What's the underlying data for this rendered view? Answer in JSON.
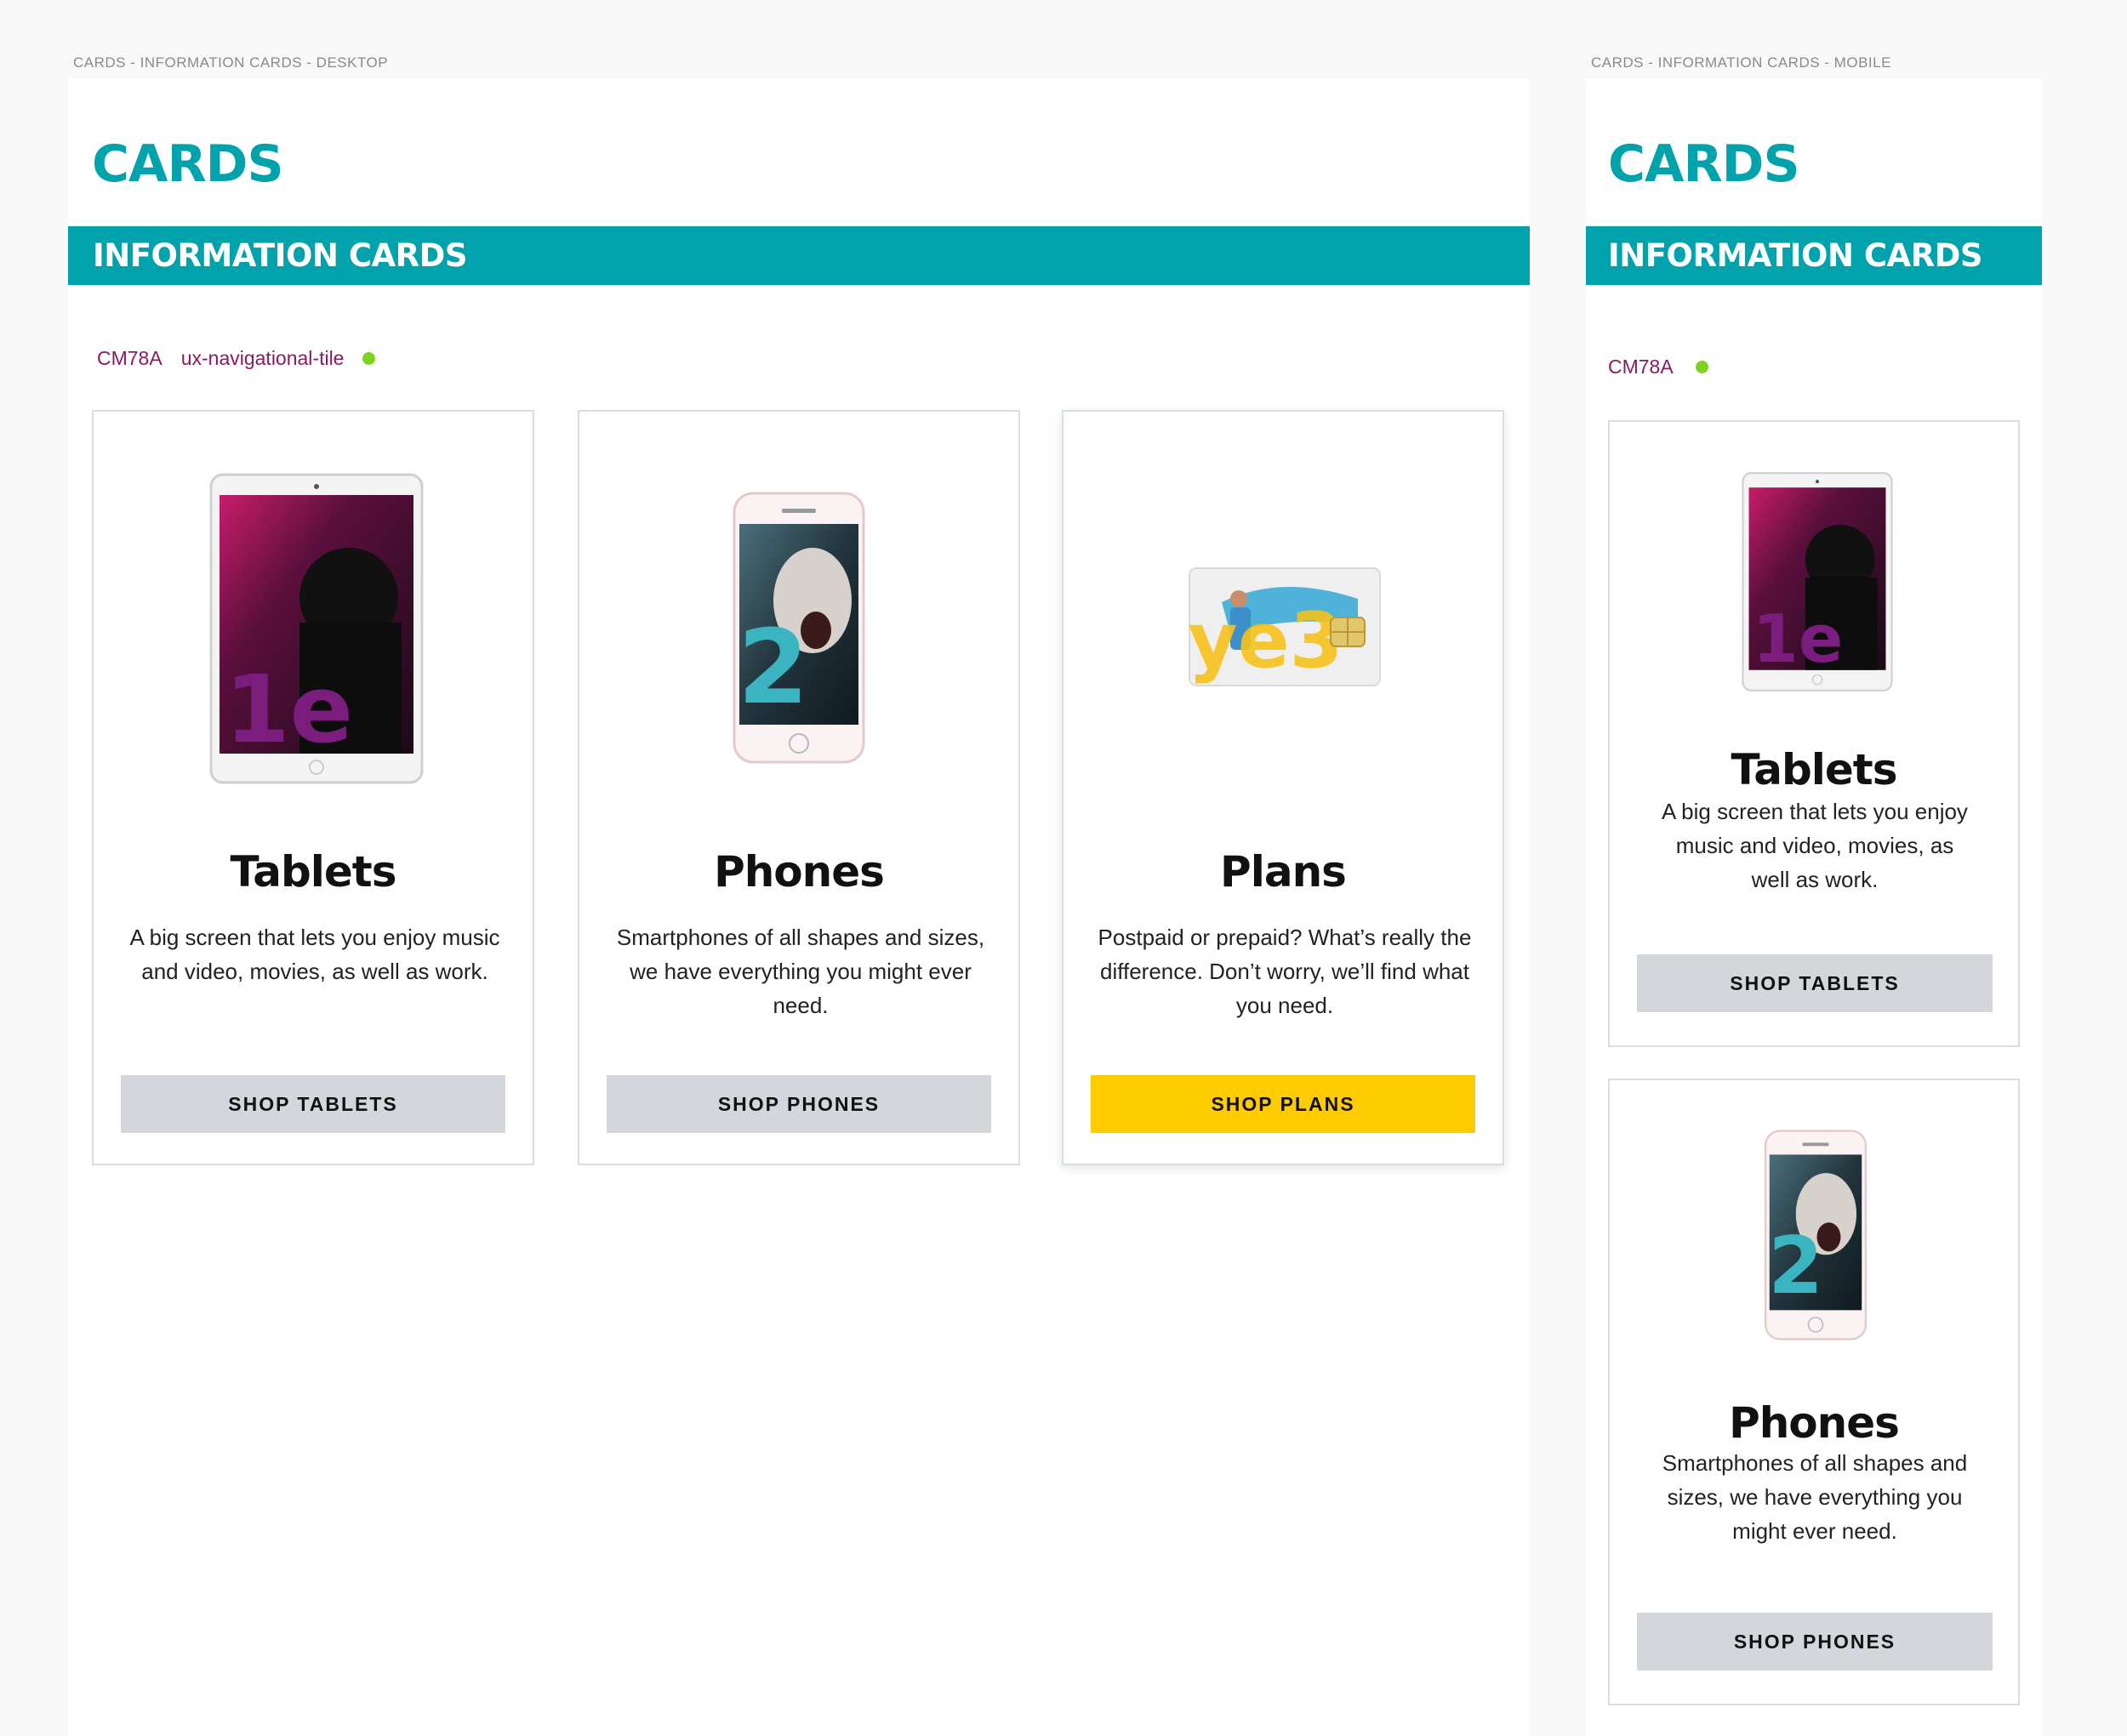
{
  "desktop": {
    "artboard_label": "CARDS - INFORMATION CARDS - DESKTOP",
    "page_title": "CARDS",
    "section_title": "INFORMATION CARDS",
    "component_code": "CM78A",
    "component_name": "ux-navigational-tile",
    "status_color": "#7ed321",
    "cards": [
      {
        "title": "Tablets",
        "description": "A big screen that lets you enjoy music and video, movies, as well as work.",
        "button_label": "SHOP TABLETS",
        "image": "tablet-image"
      },
      {
        "title": "Phones",
        "description": "Smartphones of all shapes and sizes, we have everything you might ever need.",
        "button_label": "SHOP PHONES",
        "image": "phone-image"
      },
      {
        "title": "Plans",
        "description": "Postpaid or prepaid? What’s really the difference. Don’t worry, we’ll find what you need.",
        "button_label": "SHOP PLANS",
        "image": "sim-card-image"
      }
    ]
  },
  "mobile": {
    "artboard_label": "CARDS - INFORMATION CARDS - MOBILE",
    "page_title": "CARDS",
    "section_title": "INFORMATION CARDS",
    "component_code": "CM78A",
    "status_color": "#7ed321",
    "cards": [
      {
        "title": "Tablets",
        "description": "A big screen that lets you enjoy music and video, movies, as well as work.",
        "button_label": "SHOP TABLETS",
        "image": "tablet-image"
      },
      {
        "title": "Phones",
        "description": "Smartphones of all shapes and sizes, we have everything you might ever need.",
        "button_label": "SHOP PHONES",
        "image": "phone-image"
      }
    ]
  },
  "colors": {
    "brand_teal": "#00a2ab",
    "accent_yellow": "#ffcc00",
    "secondary_button": "#d3d7db",
    "code_purple": "#8a1a62"
  }
}
